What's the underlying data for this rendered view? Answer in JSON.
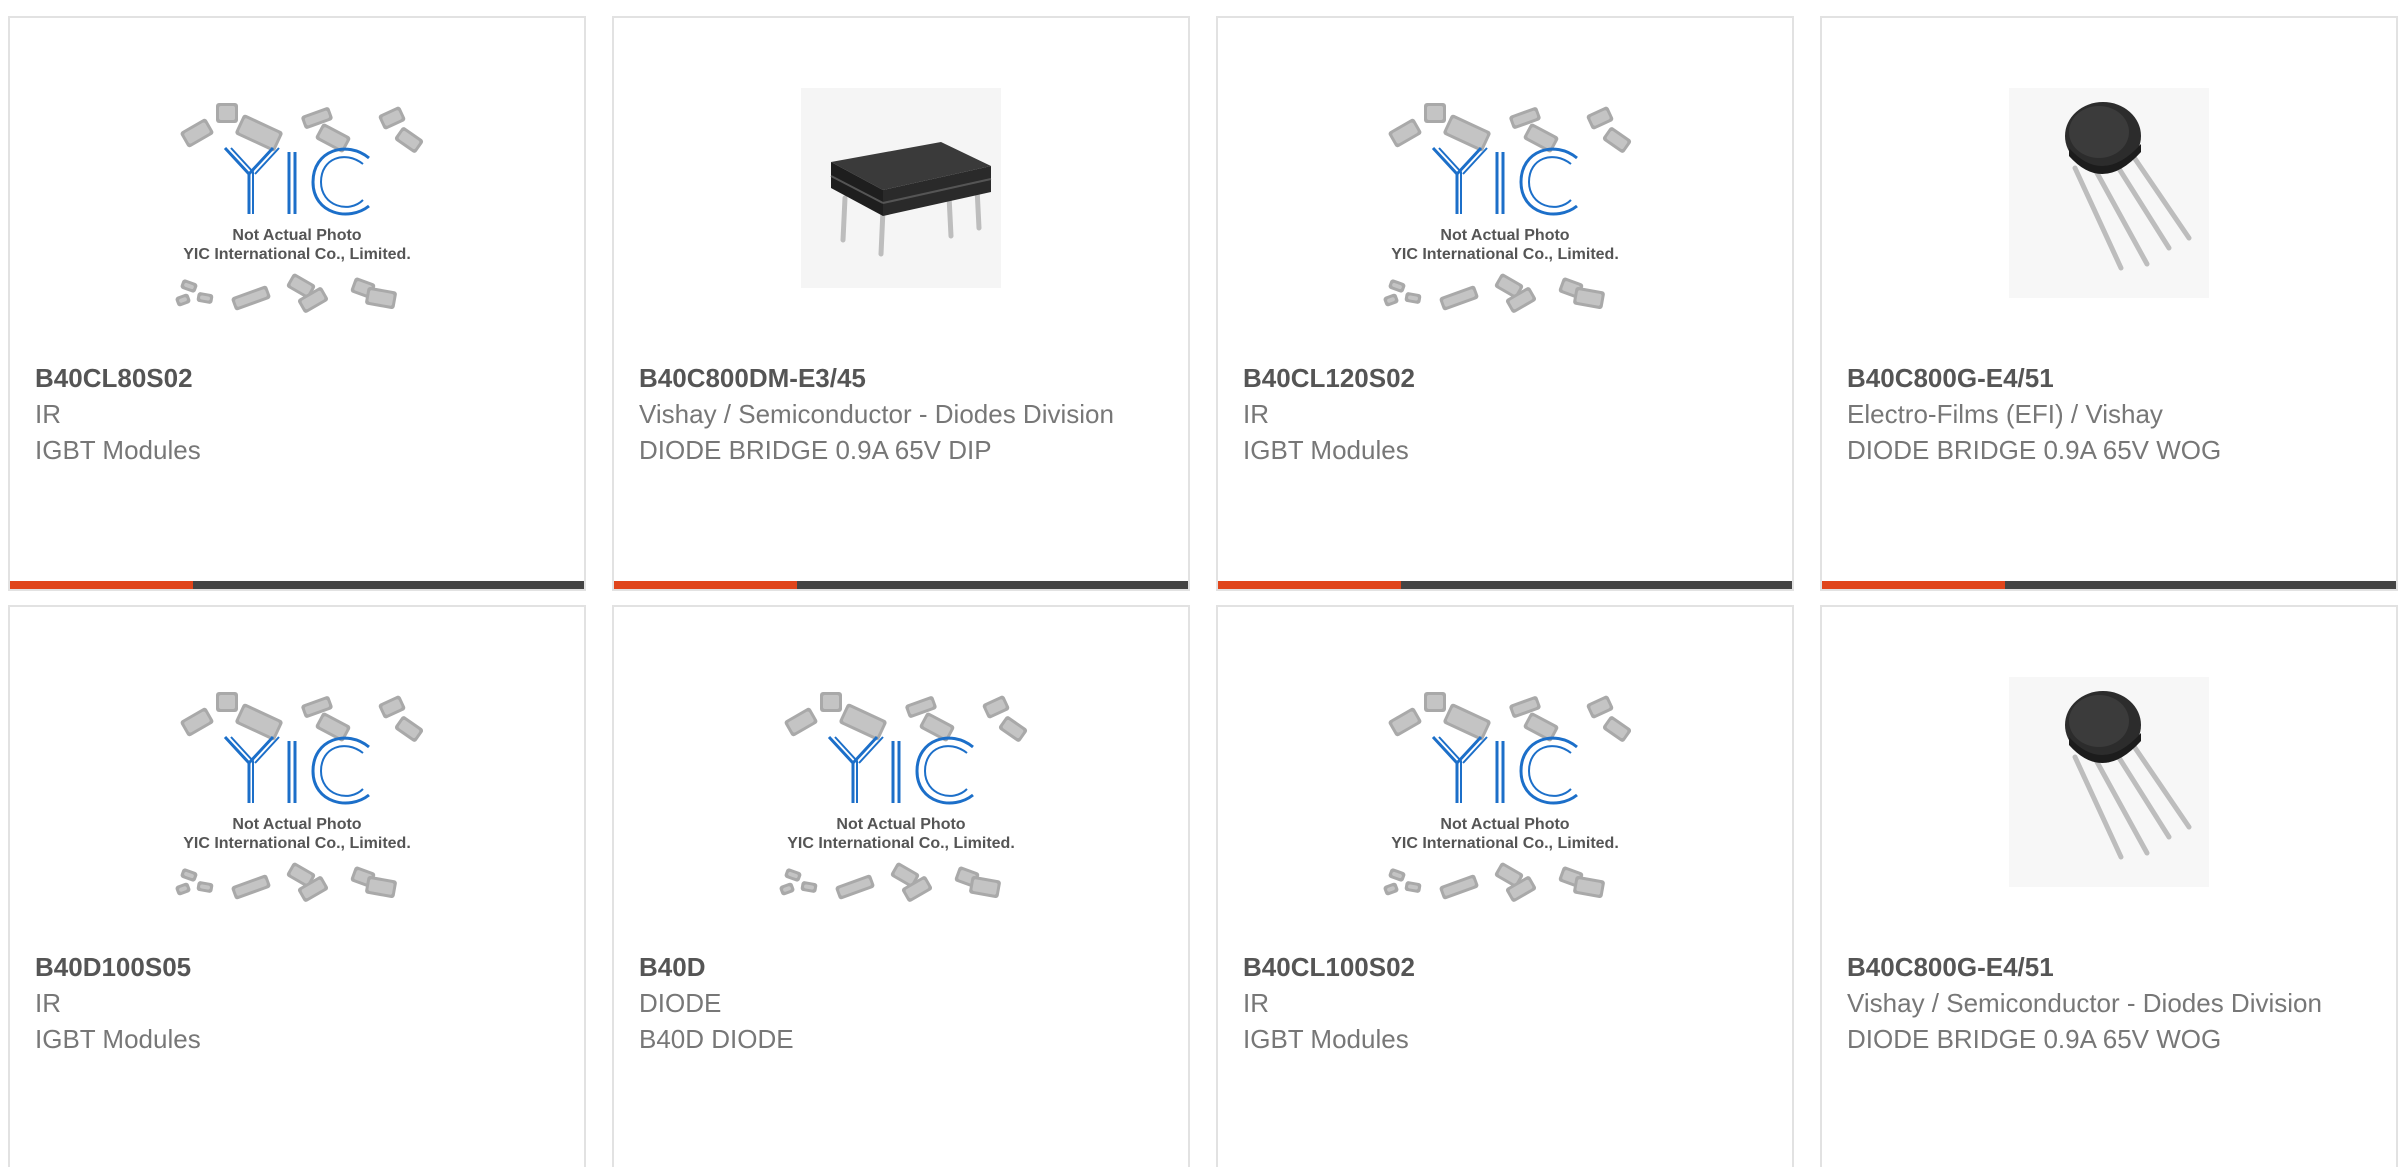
{
  "theme": {
    "accent": "#e0451b",
    "bar": "#444444",
    "border": "#e2e2e2",
    "title_color": "#555555",
    "text_color": "#777777"
  },
  "placeholder": {
    "logo": "YIC",
    "line1": "Not Actual Photo",
    "line2": "YIC International Co., Limited."
  },
  "products": [
    {
      "part_number": "B40CL80S02",
      "manufacturer": "IR",
      "description": "IGBT Modules",
      "image": "placeholder-logo"
    },
    {
      "part_number": "B40C800DM-E3/45",
      "manufacturer": "Vishay / Semiconductor - Diodes Division",
      "description": "DIODE BRIDGE 0.9A 65V DIP",
      "image": "dip-bridge-photo"
    },
    {
      "part_number": "B40CL120S02",
      "manufacturer": "IR",
      "description": "IGBT Modules",
      "image": "placeholder-logo"
    },
    {
      "part_number": "B40C800G-E4/51",
      "manufacturer": "Electro-Films (EFI) / Vishay",
      "description": "DIODE BRIDGE 0.9A 65V WOG",
      "image": "wog-bridge-photo"
    },
    {
      "part_number": "B40D100S05",
      "manufacturer": "IR",
      "description": "IGBT Modules",
      "image": "placeholder-logo"
    },
    {
      "part_number": "B40D",
      "manufacturer": "DIODE",
      "description": "B40D DIODE",
      "image": "placeholder-logo"
    },
    {
      "part_number": "B40CL100S02",
      "manufacturer": "IR",
      "description": "IGBT Modules",
      "image": "placeholder-logo"
    },
    {
      "part_number": "B40C800G-E4/51",
      "manufacturer": "Vishay / Semiconductor - Diodes Division",
      "description": "DIODE BRIDGE 0.9A 65V WOG",
      "image": "wog-bridge-photo"
    }
  ]
}
